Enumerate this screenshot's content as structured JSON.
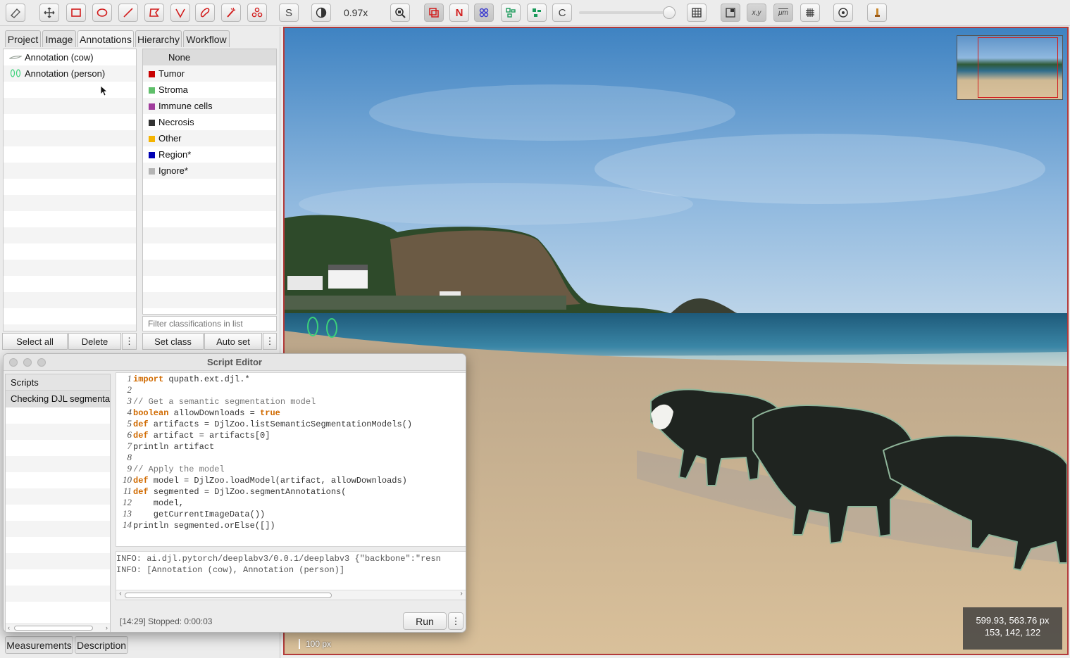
{
  "toolbar": {
    "zoom": "0.97x",
    "icons": [
      "hide-icon",
      "move-icon",
      "rectangle-icon",
      "ellipse-icon",
      "line-icon",
      "polygon-icon",
      "polyline-icon",
      "brush-icon",
      "wand-icon",
      "points-icon",
      "selection-mode-icon",
      "brightness-contrast-icon",
      "zoom-to-fit-icon",
      "show-annotations-icon",
      "show-names-icon",
      "show-tma-grid-icon",
      "show-detections-icon",
      "fill-detections-icon",
      "show-classifications-icon",
      "opacity-slider",
      "show-pixel-grid-icon",
      "show-overview-icon",
      "show-cursor-location-icon",
      "show-scalebar-icon",
      "show-grid-icon",
      "preferences-icon",
      "log-viewer-icon"
    ],
    "selection_label": "S",
    "names_label": "N",
    "classification_label": "C"
  },
  "tabs": [
    "Project",
    "Image",
    "Annotations",
    "Hierarchy",
    "Workflow"
  ],
  "annotations": [
    {
      "label": "Annotation (cow)",
      "color": "#9aa39a"
    },
    {
      "label": "Annotation (person)",
      "color": "#3cd17a"
    }
  ],
  "classes": [
    {
      "label": "None",
      "color": ""
    },
    {
      "label": "Tumor",
      "color": "#c80000"
    },
    {
      "label": "Stroma",
      "color": "#5fbf6a"
    },
    {
      "label": "Immune cells",
      "color": "#a03c9c"
    },
    {
      "label": "Necrosis",
      "color": "#333333"
    },
    {
      "label": "Other",
      "color": "#f5b400"
    },
    {
      "label": "Region*",
      "color": "#0000b4"
    },
    {
      "label": "Ignore*",
      "color": "#b4b4b4"
    }
  ],
  "filter_placeholder": "Filter classifications in list",
  "buttons": {
    "select_all": "Select all",
    "delete": "Delete",
    "set_class": "Set class",
    "auto_set": "Auto set",
    "more": "⋮",
    "run": "Run"
  },
  "bottom_tabs": [
    "Measurements",
    "Description"
  ],
  "script_editor": {
    "title": "Script Editor",
    "scripts_header": "Scripts",
    "script_item": "Checking DJL segmenta",
    "status": "[14:29]  Stopped: 0:00:03",
    "code": [
      {
        "n": "1",
        "parts": [
          [
            "kw",
            "import"
          ],
          [
            "",
            " qupath.ext.djl.*"
          ]
        ]
      },
      {
        "n": "2",
        "parts": [
          [
            "",
            ""
          ]
        ]
      },
      {
        "n": "3",
        "parts": [
          [
            "cm",
            "// Get a semantic segmentation model"
          ]
        ]
      },
      {
        "n": "4",
        "parts": [
          [
            "kw",
            "boolean"
          ],
          [
            "",
            " allowDownloads = "
          ],
          [
            "kw",
            "true"
          ]
        ]
      },
      {
        "n": "5",
        "parts": [
          [
            "kw",
            "def"
          ],
          [
            "",
            " artifacts = DjlZoo.listSemanticSegmentationModels()"
          ]
        ]
      },
      {
        "n": "6",
        "parts": [
          [
            "kw",
            "def"
          ],
          [
            "",
            " artifact = artifacts[0]"
          ]
        ]
      },
      {
        "n": "7",
        "parts": [
          [
            "",
            "println artifact"
          ]
        ]
      },
      {
        "n": "8",
        "parts": [
          [
            "",
            ""
          ]
        ]
      },
      {
        "n": "9",
        "parts": [
          [
            "cm",
            "// Apply the model"
          ]
        ]
      },
      {
        "n": "10",
        "parts": [
          [
            "kw",
            "def"
          ],
          [
            "",
            " model = DjlZoo.loadModel(artifact, allowDownloads)"
          ]
        ]
      },
      {
        "n": "11",
        "parts": [
          [
            "kw",
            "def"
          ],
          [
            "",
            " segmented = DjlZoo.segmentAnnotations("
          ]
        ]
      },
      {
        "n": "12",
        "parts": [
          [
            "",
            "    model,"
          ]
        ]
      },
      {
        "n": "13",
        "parts": [
          [
            "",
            "    getCurrentImageData())"
          ]
        ]
      },
      {
        "n": "14",
        "parts": [
          [
            "",
            "println segmented.orElse([])"
          ]
        ]
      }
    ],
    "console": [
      "INFO: ai.djl.pytorch/deeplabv3/0.0.1/deeplabv3 {\"backbone\":\"resn",
      "INFO: [Annotation (cow), Annotation (person)]"
    ]
  },
  "viewer": {
    "scalebar": "100 px",
    "cursor_coords": "599.93, 563.76 px",
    "cursor_rgb": "153, 142, 122"
  }
}
